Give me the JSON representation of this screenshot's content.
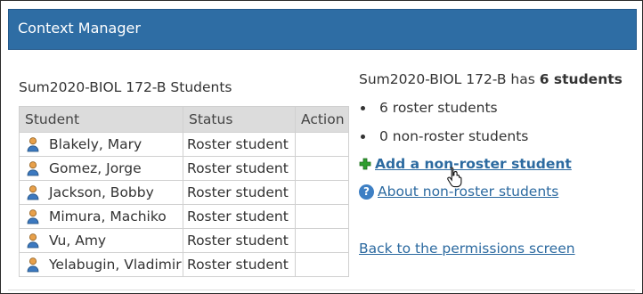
{
  "header": {
    "title": "Context Manager"
  },
  "table": {
    "title": "Sum2020-BIOL 172-B Students",
    "columns": [
      "Student",
      "Status",
      "Action"
    ],
    "rows": [
      {
        "student": "Blakely, Mary",
        "status": "Roster student",
        "action": ""
      },
      {
        "student": "Gomez, Jorge",
        "status": "Roster student",
        "action": ""
      },
      {
        "student": "Jackson, Bobby",
        "status": "Roster student",
        "action": ""
      },
      {
        "student": "Mimura, Machiko",
        "status": "Roster student",
        "action": ""
      },
      {
        "student": "Vu, Amy",
        "status": "Roster student",
        "action": ""
      },
      {
        "student": "Yelabugin, Vladimir",
        "status": "Roster student",
        "action": ""
      }
    ]
  },
  "summary": {
    "prefix": "Sum2020-BIOL 172-B has ",
    "count": "6 students",
    "bullets": [
      "6 roster students",
      "0 non-roster students"
    ]
  },
  "links": {
    "add_non_roster": "Add a non-roster student",
    "about_non_roster": "About non-roster students",
    "back_permissions": "Back to the permissions screen"
  },
  "icons": {
    "student": "person-icon",
    "add": "plus-icon",
    "help": "help-icon",
    "cursor": "hand-cursor-icon"
  },
  "colors": {
    "header_bg": "#2e6da4",
    "link": "#2c6aa0",
    "table_header_bg": "#dcdcdc",
    "plus": "#2f9e2f"
  }
}
